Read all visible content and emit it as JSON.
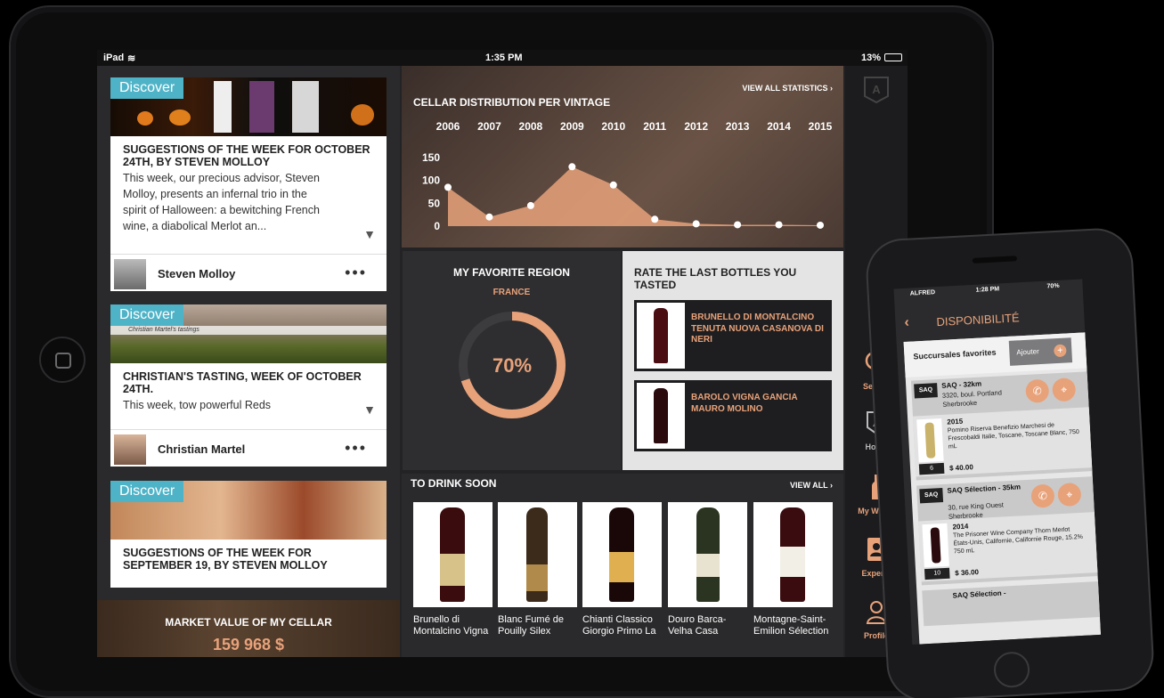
{
  "statusbar": {
    "carrier": "iPad",
    "time": "1:35 PM",
    "battery": "13%"
  },
  "cards": [
    {
      "tag": "Discover",
      "title": "SUGGESTIONS OF THE WEEK FOR OCTOBER 24TH, BY STEVEN MOLLOY",
      "body": "This week, our precious advisor, Steven Molloy, presents an infernal trio in the spirit of Halloween: a bewitching French wine, a diabolical Merlot an...",
      "author": "Steven Molloy",
      "banner_caption": ""
    },
    {
      "tag": "Discover",
      "title": "CHRISTIAN'S TASTING, WEEK OF OCTOBER 24TH.",
      "body": "This week, tow powerful Reds",
      "author": "Christian Martel",
      "banner_caption": "Christian Martel's tastings"
    },
    {
      "tag": "Discover",
      "title": "SUGGESTIONS OF THE WEEK FOR SEPTEMBER 19, BY STEVEN MOLLOY",
      "body": "",
      "author": "",
      "banner_caption": ""
    }
  ],
  "market": {
    "label": "MARKET VALUE OF MY CELLAR",
    "value": "159 968 $"
  },
  "chart": {
    "view_all": "VIEW ALL STATISTICS ›"
  },
  "chart_data": {
    "type": "area",
    "title": "CELLAR DISTRIBUTION PER VINTAGE",
    "categories": [
      "2006",
      "2007",
      "2008",
      "2009",
      "2010",
      "2011",
      "2012",
      "2013",
      "2014",
      "2015"
    ],
    "values": [
      85,
      20,
      45,
      130,
      90,
      15,
      5,
      3,
      3,
      2
    ],
    "ylim": [
      0,
      150
    ],
    "yticks": [
      "150",
      "100",
      "50",
      "0"
    ],
    "grid": false,
    "color": "#e8a27a"
  },
  "region": {
    "title": "MY FAVORITE REGION",
    "name": "FRANCE",
    "percent_label": "70%",
    "percent": 70,
    "accent": "#e8a27a"
  },
  "rate": {
    "title": "RATE THE LAST BOTTLES YOU TASTED",
    "bottles": [
      {
        "name": "BRUNELLO DI MONTALCINO TENUTA NUOVA CASANOVA DI NERI"
      },
      {
        "name": "BAROLO VIGNA GANCIA MAURO MOLINO"
      }
    ]
  },
  "drink": {
    "title": "TO DRINK SOON",
    "view_all": "VIEW ALL ›",
    "wines": [
      {
        "line1": "Brunello di",
        "line2": "Montalcino Vigna"
      },
      {
        "line1": "Blanc Fumé de",
        "line2": "Pouilly Silex"
      },
      {
        "line1": "Chianti Classico",
        "line2": "Giorgio Primo La"
      },
      {
        "line1": "Douro Barca-",
        "line2": "Velha Casa"
      },
      {
        "line1": "Montagne-Saint-",
        "line2": "Emilion Sélection"
      }
    ]
  },
  "nav": {
    "search": "Search",
    "home": "Home",
    "mywines": "My Wines",
    "experts": "Experts",
    "profile": "Profile"
  },
  "phone": {
    "status": {
      "carrier": "ALFRED",
      "time": "1:28 PM",
      "battery": "70%"
    },
    "title": "DISPONIBILITÉ",
    "favorites_label": "Succursales favorites",
    "add_label": "Ajouter",
    "stores": [
      {
        "logo": "SAQ",
        "name": "SAQ - 32km",
        "address": "3320, boul. Portland Sherbrooke",
        "year": "2015",
        "wine": "Pomino Riserva Benefizio Marchesi de Frescobaldi Italie, Toscane, Toscane Blanc, 750 mL",
        "qty": "6",
        "price": "$ 40.00"
      },
      {
        "logo": "SAQ",
        "name": "SAQ Sélection - 35km",
        "address": "30, rue King Ouest Sherbrooke",
        "year": "2014",
        "wine": "The Prisoner Wine Company Thorn Merlot États-Unis, Californie, Californie Rouge, 15.2% 750 mL",
        "qty": "10",
        "price": "$ 36.00"
      }
    ],
    "next_store": "SAQ Sélection -"
  }
}
